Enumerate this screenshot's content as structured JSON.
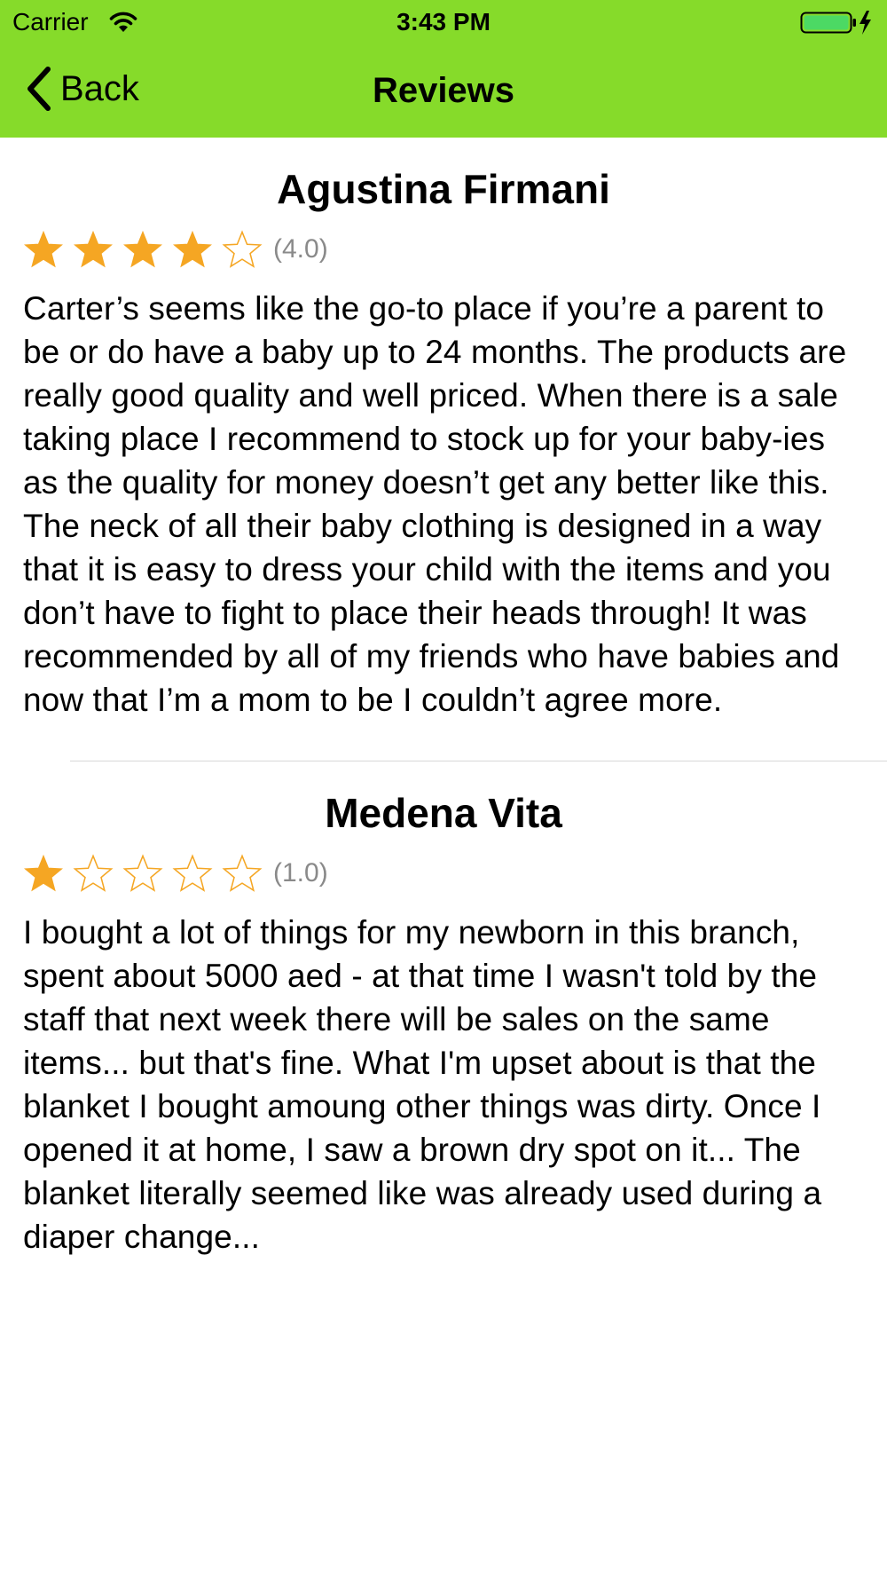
{
  "status_bar": {
    "carrier": "Carrier",
    "time": "3:43 PM",
    "wifi_icon": "wifi-icon",
    "battery_icon": "battery-charging-icon",
    "battery_color": "#4cd964"
  },
  "nav": {
    "back_label": "Back",
    "back_icon": "chevron-left-icon",
    "title": "Reviews",
    "background_color": "#86db2a"
  },
  "star_color": "#f5a623",
  "reviews": [
    {
      "name": "Agustina Firmani",
      "rating": 4,
      "rating_label": "(4.0)",
      "text": "Carter’s seems like the go-to place if you’re a parent to be or do have a baby up to 24 months. The products are really good quality and well priced. When there is a sale taking place I recommend to stock up for your baby-ies as the quality for money doesn’t get any better like this. The neck of all their baby clothing is designed in a way that it is easy to dress your child with the items and you don’t have to fight to place their heads through! It was recommended by all of my friends who have babies and now that I’m a mom to be I couldn’t agree more."
    },
    {
      "name": "Medena Vita",
      "rating": 1,
      "rating_label": "(1.0)",
      "text": "I bought a lot of things for my newborn in this branch, spent about 5000 aed - at that time I wasn't told by the staff that next week there will be sales on the same items... but that's fine. What I'm upset about is that the blanket I bought amoung other things was dirty. Once I opened it at home, I saw a brown dry spot on it... The blanket literally seemed like was already used during a diaper change..."
    }
  ]
}
